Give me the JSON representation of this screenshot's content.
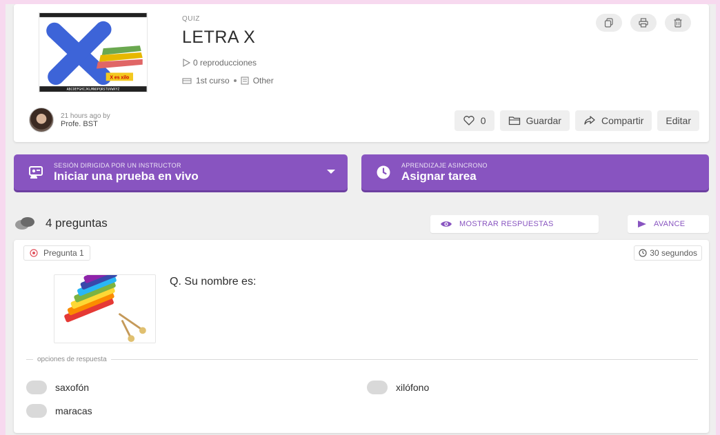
{
  "quiz": {
    "kind": "QUIZ",
    "title": "LETRA X",
    "plays": "0 reproducciones",
    "grade": "1st curso",
    "subject": "Other",
    "created": "21 hours ago by",
    "author": "Profe. BST",
    "thumb_caption": "X es xilo"
  },
  "top_icons": [
    "copy-icon",
    "print-icon",
    "trash-icon"
  ],
  "actions": {
    "likes": "0",
    "save": "Guardar",
    "share": "Compartir",
    "edit": "Editar"
  },
  "live": {
    "sub": "SESIÓN DIRIGIDA POR UN INSTRUCTOR",
    "main": "Iniciar una prueba en vivo"
  },
  "assign": {
    "sub": "APRENDIZAJE ASINCRONO",
    "main": "Asignar tarea"
  },
  "questions_header": {
    "count": "4 preguntas",
    "show_answers": "MOSTRAR RESPUESTAS",
    "preview": "AVANCE"
  },
  "question": {
    "badge": "Pregunta 1",
    "time": "30 segundos",
    "text": "Q. Su nombre es:",
    "options_label": "opciones de respuesta",
    "options": [
      "saxofón",
      "xilófono",
      "maracas"
    ]
  },
  "colors": {
    "accent": "#8854c0",
    "frame": "#f7d9ef",
    "background": "#efefef"
  }
}
